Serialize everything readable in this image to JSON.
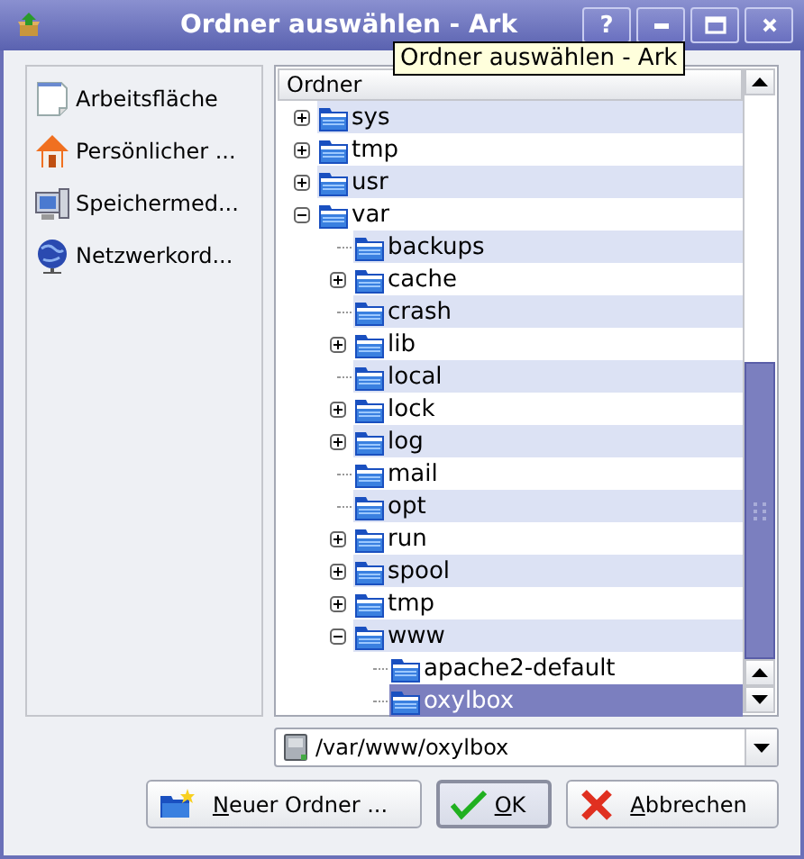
{
  "window": {
    "title": "Ordner auswählen - Ark",
    "buttons": [
      "?"
    ]
  },
  "tooltip": "Ordner auswählen - Ark",
  "places": [
    {
      "label": "Arbeitsfläche",
      "kind": "desktop"
    },
    {
      "label": "Persönlicher ...",
      "kind": "home"
    },
    {
      "label": "Speichermed...",
      "kind": "storage"
    },
    {
      "label": "Netzwerkord...",
      "kind": "network"
    }
  ],
  "tree": {
    "header": "Ordner",
    "items": [
      {
        "label": "sys",
        "kind": "branch",
        "expanded": false,
        "selected": false
      },
      {
        "label": "tmp",
        "kind": "branch",
        "expanded": false,
        "selected": false
      },
      {
        "label": "usr",
        "kind": "branch",
        "expanded": false,
        "selected": false
      },
      {
        "label": "var",
        "kind": "branch",
        "expanded": true,
        "selected": false,
        "children": [
          {
            "label": "backups",
            "kind": "leaf",
            "selected": false
          },
          {
            "label": "cache",
            "kind": "branch",
            "expanded": false,
            "selected": false
          },
          {
            "label": "crash",
            "kind": "leaf",
            "selected": false
          },
          {
            "label": "lib",
            "kind": "branch",
            "expanded": false,
            "selected": false
          },
          {
            "label": "local",
            "kind": "leaf",
            "selected": false
          },
          {
            "label": "lock",
            "kind": "branch",
            "expanded": false,
            "selected": false
          },
          {
            "label": "log",
            "kind": "branch",
            "expanded": false,
            "selected": false
          },
          {
            "label": "mail",
            "kind": "leaf",
            "selected": false
          },
          {
            "label": "opt",
            "kind": "leaf",
            "selected": false
          },
          {
            "label": "run",
            "kind": "branch",
            "expanded": false,
            "selected": false
          },
          {
            "label": "spool",
            "kind": "branch",
            "expanded": false,
            "selected": false
          },
          {
            "label": "tmp",
            "kind": "branch",
            "expanded": false,
            "selected": false
          },
          {
            "label": "www",
            "kind": "branch",
            "expanded": true,
            "selected": false,
            "children": [
              {
                "label": "apache2-default",
                "kind": "leaf",
                "selected": false
              },
              {
                "label": "oxylbox",
                "kind": "leaf",
                "selected": true
              }
            ]
          }
        ]
      }
    ]
  },
  "path": "/var/www/oxylbox",
  "buttons": [
    {
      "kind": "new-folder",
      "mnemonic": "N",
      "rest": "euer Ordner ...",
      "default": false
    },
    {
      "kind": "ok",
      "mnemonic": "O",
      "rest": "K",
      "default": true
    },
    {
      "kind": "cancel",
      "mnemonic": "A",
      "rest": "bbrechen",
      "default": false
    }
  ]
}
